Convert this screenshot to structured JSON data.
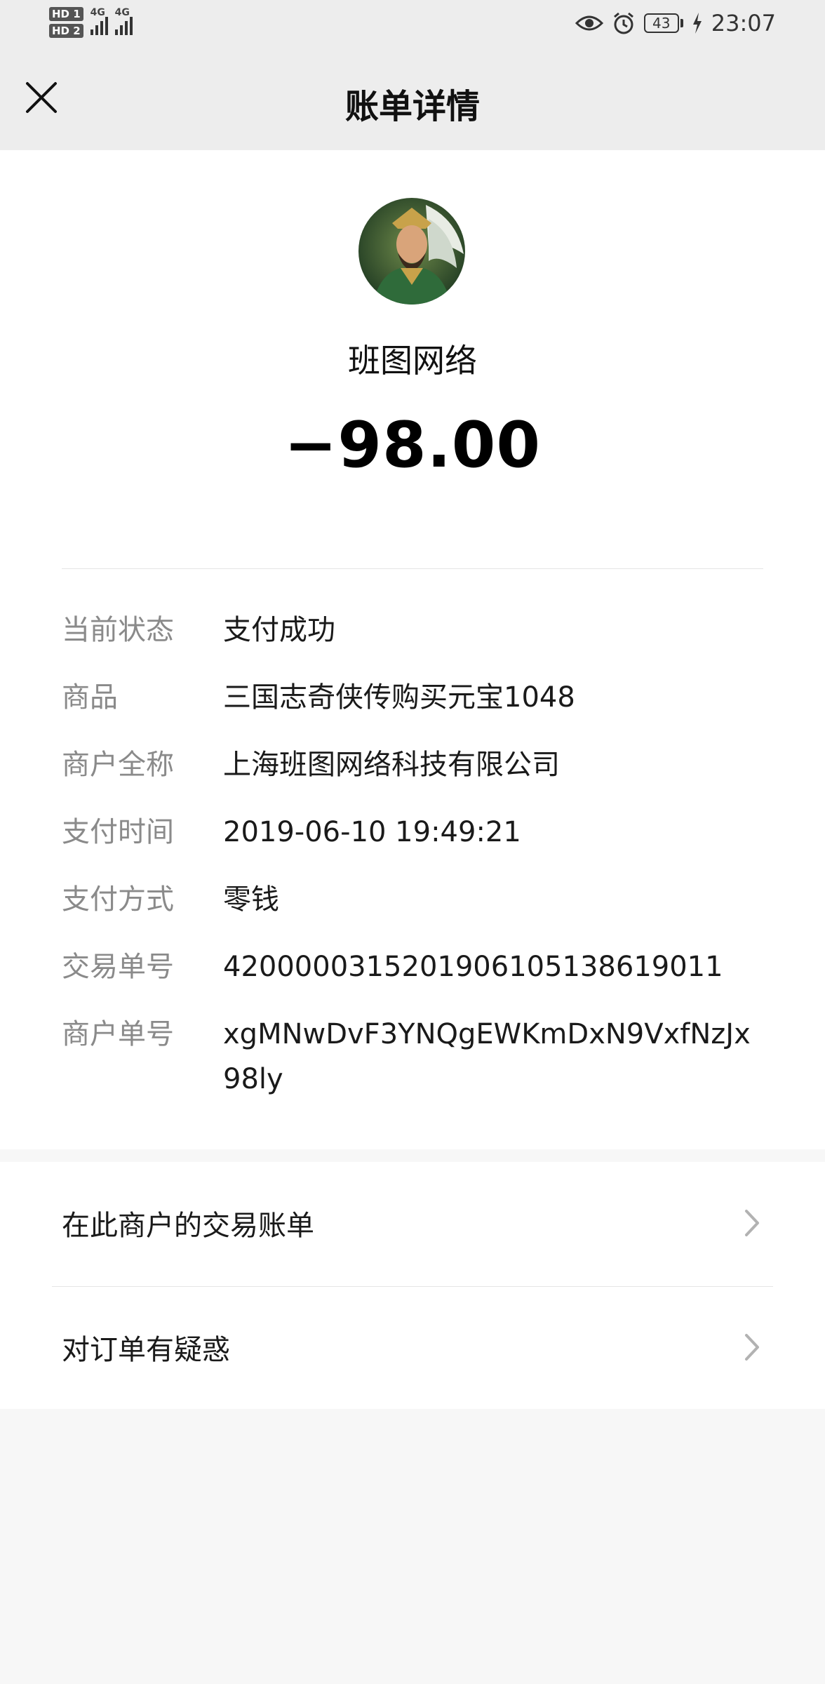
{
  "status_bar": {
    "sim1": "HD 1",
    "sim2": "HD 2",
    "network1": "4G",
    "network2": "4G",
    "battery": "43",
    "time": "23:07"
  },
  "nav": {
    "title": "账单详情"
  },
  "bill": {
    "merchant_display_name": "班图网络",
    "amount": "−98.00"
  },
  "details": [
    {
      "key": "当前状态",
      "value": "支付成功"
    },
    {
      "key": "商品",
      "value": "三国志奇侠传购买元宝1048"
    },
    {
      "key": "商户全称",
      "value": "上海班图网络科技有限公司"
    },
    {
      "key": "支付时间",
      "value": "2019-06-10 19:49:21"
    },
    {
      "key": "支付方式",
      "value": "零钱"
    },
    {
      "key": "交易单号",
      "value": "4200000315201906105138619011"
    },
    {
      "key": "商户单号",
      "value": "xgMNwDvF3YNQgEWKmDxN9VxfNzJx98ly"
    }
  ],
  "actions": [
    {
      "label": "在此商户的交易账单"
    },
    {
      "label": "对订单有疑惑"
    }
  ]
}
